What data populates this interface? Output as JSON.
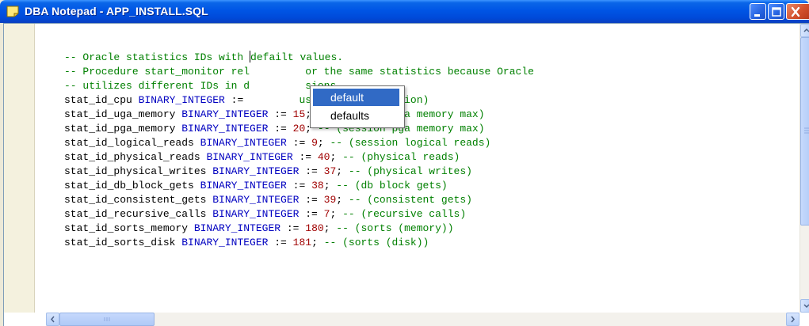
{
  "window": {
    "title": "DBA Notepad - APP_INSTALL.SQL",
    "icon": "notepad-icon"
  },
  "editor": {
    "lines": [
      [
        {
          "t": "-- Oracle statistics IDs with ",
          "c": "cmt"
        },
        {
          "t": "",
          "c": "cursor"
        },
        {
          "t": "defailt values.",
          "c": "cmt"
        }
      ],
      [
        {
          "t": "-- Procedure start_monitor rel",
          "c": "cmt"
        },
        {
          "t": "         ",
          "c": "cmt"
        },
        {
          "t": "or the same statistics because Oracle",
          "c": "cmt"
        }
      ],
      [
        {
          "t": "-- utilizes different IDs in d",
          "c": "cmt"
        },
        {
          "t": "         ",
          "c": "cmt"
        },
        {
          "t": "sions",
          "c": "cmt"
        }
      ],
      [
        {
          "t": "stat_id_cpu ",
          "c": "id"
        },
        {
          "t": "BINARY_INTEGER",
          "c": "kw"
        },
        {
          "t": " := ",
          "c": "id"
        },
        {
          "t": "        ",
          "c": "num"
        },
        {
          "t": "used by this session)",
          "c": "cmt"
        }
      ],
      [
        {
          "t": "stat_id_uga_memory ",
          "c": "id"
        },
        {
          "t": "BINARY_INTEGER",
          "c": "kw"
        },
        {
          "t": " := ",
          "c": "id"
        },
        {
          "t": "15",
          "c": "num"
        },
        {
          "t": "; ",
          "c": "id"
        },
        {
          "t": "-- (session uga memory max)",
          "c": "cmt"
        }
      ],
      [
        {
          "t": "stat_id_pga_memory ",
          "c": "id"
        },
        {
          "t": "BINARY_INTEGER",
          "c": "kw"
        },
        {
          "t": " := ",
          "c": "id"
        },
        {
          "t": "20",
          "c": "num"
        },
        {
          "t": "; ",
          "c": "id"
        },
        {
          "t": "-- (session pga memory max)",
          "c": "cmt"
        }
      ],
      [
        {
          "t": "stat_id_logical_reads ",
          "c": "id"
        },
        {
          "t": "BINARY_INTEGER",
          "c": "kw"
        },
        {
          "t": " := ",
          "c": "id"
        },
        {
          "t": "9",
          "c": "num"
        },
        {
          "t": "; ",
          "c": "id"
        },
        {
          "t": "-- (session logical reads)",
          "c": "cmt"
        }
      ],
      [
        {
          "t": "stat_id_physical_reads ",
          "c": "id"
        },
        {
          "t": "BINARY_INTEGER",
          "c": "kw"
        },
        {
          "t": " := ",
          "c": "id"
        },
        {
          "t": "40",
          "c": "num"
        },
        {
          "t": "; ",
          "c": "id"
        },
        {
          "t": "-- (physical reads)",
          "c": "cmt"
        }
      ],
      [
        {
          "t": "stat_id_physical_writes ",
          "c": "id"
        },
        {
          "t": "BINARY_INTEGER",
          "c": "kw"
        },
        {
          "t": " := ",
          "c": "id"
        },
        {
          "t": "37",
          "c": "num"
        },
        {
          "t": "; ",
          "c": "id"
        },
        {
          "t": "-- (physical writes)",
          "c": "cmt"
        }
      ],
      [
        {
          "t": "stat_id_db_block_gets ",
          "c": "id"
        },
        {
          "t": "BINARY_INTEGER",
          "c": "kw"
        },
        {
          "t": " := ",
          "c": "id"
        },
        {
          "t": "38",
          "c": "num"
        },
        {
          "t": "; ",
          "c": "id"
        },
        {
          "t": "-- (db block gets)",
          "c": "cmt"
        }
      ],
      [
        {
          "t": "stat_id_consistent_gets ",
          "c": "id"
        },
        {
          "t": "BINARY_INTEGER",
          "c": "kw"
        },
        {
          "t": " := ",
          "c": "id"
        },
        {
          "t": "39",
          "c": "num"
        },
        {
          "t": "; ",
          "c": "id"
        },
        {
          "t": "-- (consistent gets)",
          "c": "cmt"
        }
      ],
      [
        {
          "t": "stat_id_recursive_calls ",
          "c": "id"
        },
        {
          "t": "BINARY_INTEGER",
          "c": "kw"
        },
        {
          "t": " := ",
          "c": "id"
        },
        {
          "t": "7",
          "c": "num"
        },
        {
          "t": "; ",
          "c": "id"
        },
        {
          "t": "-- (recursive calls)",
          "c": "cmt"
        }
      ],
      [
        {
          "t": "stat_id_sorts_memory ",
          "c": "id"
        },
        {
          "t": "BINARY_INTEGER",
          "c": "kw"
        },
        {
          "t": " := ",
          "c": "id"
        },
        {
          "t": "180",
          "c": "num"
        },
        {
          "t": "; ",
          "c": "id"
        },
        {
          "t": "-- (sorts (memory))",
          "c": "cmt"
        }
      ],
      [
        {
          "t": "stat_id_sorts_disk ",
          "c": "id"
        },
        {
          "t": "BINARY_INTEGER",
          "c": "kw"
        },
        {
          "t": " := ",
          "c": "id"
        },
        {
          "t": "181",
          "c": "num"
        },
        {
          "t": "; ",
          "c": "id"
        },
        {
          "t": "-- (sorts (disk))",
          "c": "cmt"
        }
      ]
    ]
  },
  "spell_suggestions": {
    "items": [
      "default",
      "defaults"
    ],
    "selected_index": 0
  },
  "colors": {
    "comment": "#008000",
    "keyword": "#0000C0",
    "number": "#A00000",
    "selection": "#316AC5",
    "title_bar": "#0055E5"
  }
}
